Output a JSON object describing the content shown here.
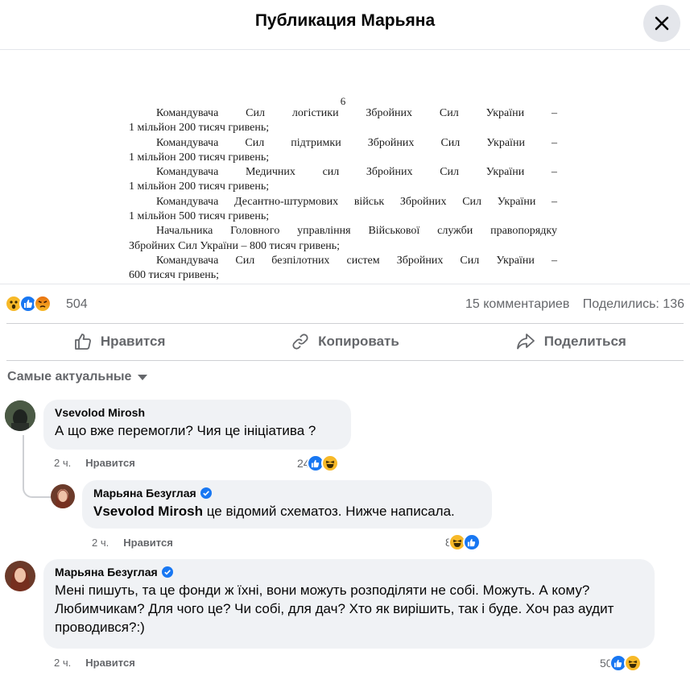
{
  "header": {
    "title": "Публикация Марьяна"
  },
  "document": {
    "page_number": "6",
    "lines": [
      {
        "style": "just",
        "words": [
          "Командувача",
          "Сил",
          "логістики",
          "Збройних",
          "Сил",
          "України",
          "–"
        ]
      },
      {
        "style": "plain",
        "text": "1 мільйон 200 тисяч гривень;"
      },
      {
        "style": "just",
        "words": [
          "Командувача",
          "Сил",
          "підтримки",
          "Збройних",
          "Сил",
          "України",
          "–"
        ]
      },
      {
        "style": "plain",
        "text": "1 мільйон 200 тисяч гривень;"
      },
      {
        "style": "just",
        "words": [
          "Командувача",
          "Медичних",
          "сил",
          "Збройних",
          "Сил",
          "України",
          "–"
        ]
      },
      {
        "style": "plain",
        "text": "1 мільйон 200 тисяч гривень;"
      },
      {
        "style": "just",
        "words": [
          "Командувача",
          "Десантно-штурмових",
          "військ",
          "Збройних",
          "Сил",
          "України",
          "–"
        ]
      },
      {
        "style": "plain",
        "text": "1 мільйон 500 тисяч гривень;"
      },
      {
        "style": "just",
        "words": [
          "Начальника",
          "Головного",
          "управління",
          "Військової",
          "служби",
          "правопорядку"
        ]
      },
      {
        "style": "plain",
        "text": "Збройних Сил України – 800 тисяч гривень;"
      },
      {
        "style": "just",
        "words": [
          "Командувача",
          "Сил",
          "безпілотних",
          "систем",
          "Збройних",
          "Сил",
          "України",
          "–"
        ]
      },
      {
        "style": "plain",
        "text": "600 тисяч гривень;"
      }
    ]
  },
  "reactions": {
    "count": "504",
    "comments": "15 комментариев",
    "shares": "Поделились: 136"
  },
  "actions": {
    "like": "Нравится",
    "copy": "Копировать",
    "share": "Поделиться"
  },
  "sort": {
    "label": "Самые актуальные"
  },
  "comments": [
    {
      "author": "Vsevolod Mirosh",
      "verified": false,
      "text": "А що вже перемогли? Чия це ініціатива ?",
      "time": "2 ч.",
      "like": "Нравится",
      "reaction_count": "24",
      "reactions": [
        "like-icon",
        "haha-icon"
      ]
    },
    {
      "author": "Марьяна Безуглая",
      "verified": true,
      "mention": "Vsevolod Mirosh",
      "text": " це відомий схематоз. Нижче написала.",
      "time": "2 ч.",
      "like": "Нравится",
      "reaction_count": "8",
      "reactions": [
        "haha-icon",
        "like-icon"
      ]
    },
    {
      "author": "Марьяна Безуглая",
      "verified": true,
      "text": "Мені пишуть, та це фонди ж їхні, вони можуть розподіляти не собі. Можуть. А кому? Любимчикам? Для чого це? Чи собі, для дач? Хто як вирішить, так і буде. Хоч раз аудит проводився?:)",
      "time": "2 ч.",
      "like": "Нравится",
      "reaction_count": "50",
      "reactions": [
        "like-icon",
        "haha-icon"
      ]
    }
  ],
  "colors": {
    "like_blue": "#1877f2",
    "haha_yellow": "#f7b928",
    "angry_orange": "#e9710f",
    "muted": "#65676b"
  }
}
